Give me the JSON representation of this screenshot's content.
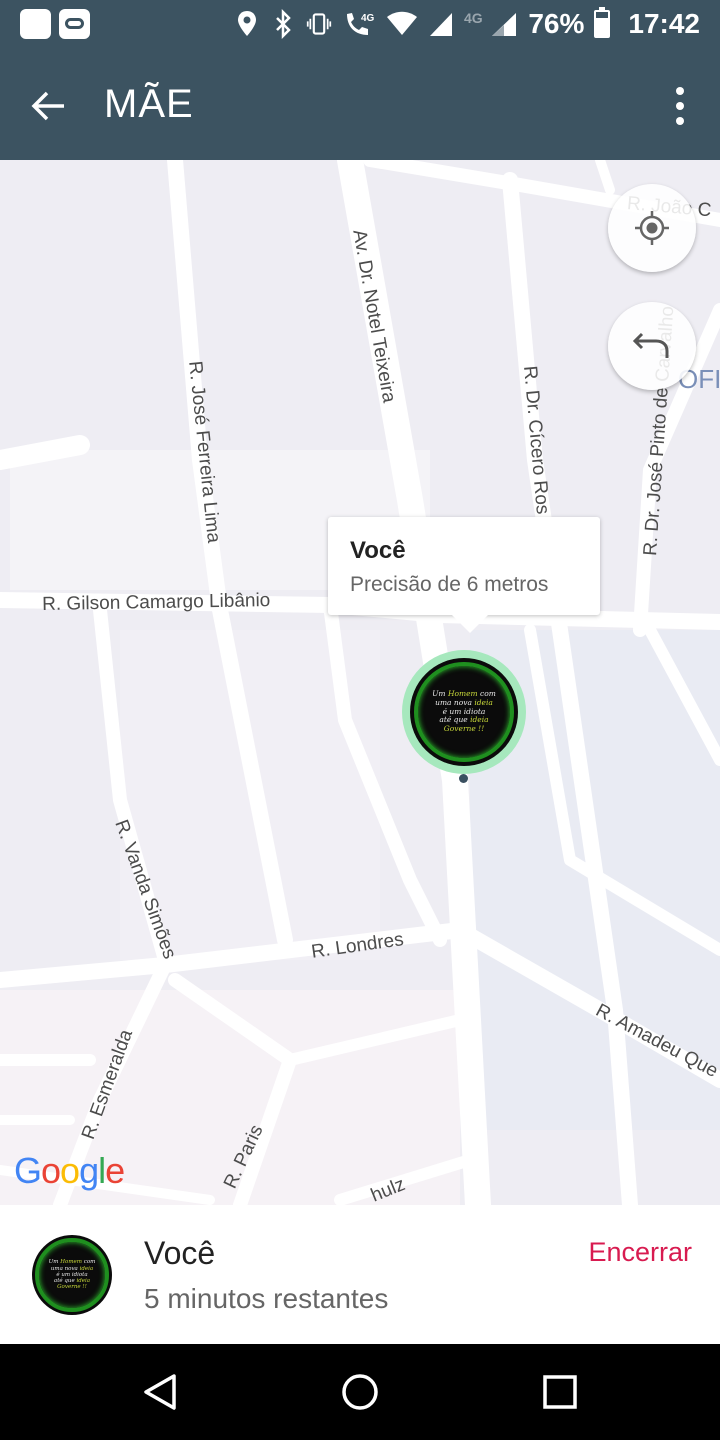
{
  "status_bar": {
    "battery_text": "76%",
    "battery_level": 0.76,
    "time": "17:42",
    "icons": [
      "app-icon",
      "infinity-icon",
      "location-icon",
      "bluetooth-icon",
      "vibrate-icon",
      "volte-call-icon",
      "wifi-icon",
      "signal-icon",
      "signal-4g-icon",
      "battery-icon"
    ],
    "net_label": "4G",
    "call_label": "4G"
  },
  "app_bar": {
    "title": "MÃE",
    "back_icon": "arrow-back-icon",
    "menu_icon": "more-vert-icon"
  },
  "map": {
    "streets": {
      "noel": "Av. Dr. Notel Teixeira",
      "jose_ferreira": "R. José Ferreira Lima",
      "cicero": "R. Dr. Cícero Ros",
      "jose_pinto": "R. Dr. José Pinto de Carvalho",
      "joao": "R. João C",
      "gilson": "R. Gilson Camargo Libânio",
      "vanda": "R. Vanda Simões",
      "londres": "R. Londres",
      "amadeu": "R. Amadeu Que",
      "esmeralda": "R. Esmeralda",
      "paris": "R. Paris",
      "schulz": "hulz",
      "ofic": "OFIC"
    },
    "popup": {
      "title": "Você",
      "subtitle": "Precisão de 6 metros"
    },
    "avatar_text": {
      "l1a": "Um ",
      "l1b": "Homem",
      "l1c": " com",
      "l2a": "uma nova ",
      "l2b": "ideia",
      "l3": "é um idiota",
      "l4a": "até que ",
      "l4b": "ideia",
      "l5": "Governe !!"
    },
    "logo": {
      "G": "G",
      "o1": "o",
      "o2": "o",
      "g": "g",
      "l": "l",
      "e": "e"
    },
    "buttons": {
      "locate_icon": "my-location-icon",
      "undo_icon": "undo-icon"
    },
    "colors": {
      "map_bg": "#f0eef3",
      "road": "#ffffff",
      "marker_ring": "#a6e8bd"
    }
  },
  "sheet": {
    "name": "Você",
    "subtitle": "5 minutos restantes",
    "end_label": "Encerrar",
    "end_color": "#d81b50"
  },
  "nav": {
    "back_icon": "nav-back-icon",
    "home_icon": "nav-home-icon",
    "recents_icon": "nav-recents-icon"
  },
  "colors": {
    "app_bar": "#3c5361"
  }
}
